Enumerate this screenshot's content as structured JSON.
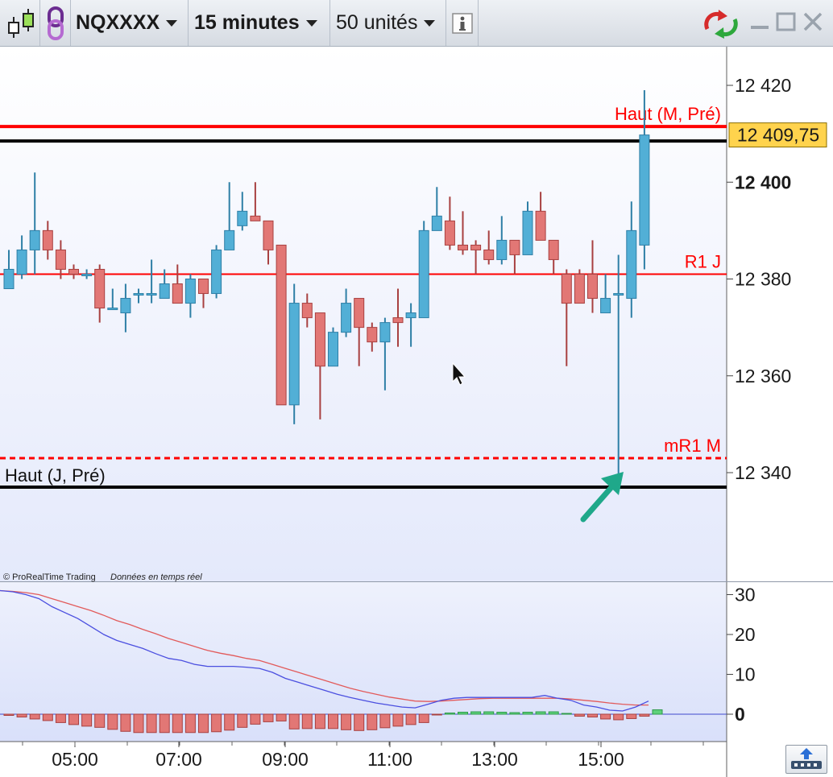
{
  "toolbar": {
    "instrument": "NQXXXX",
    "timeframe": "15 minutes",
    "units": "50 unités",
    "icons": [
      "candlestick-type-icon",
      "link-icon",
      "info-icon",
      "refresh-icon",
      "minimize-icon",
      "maximize-icon",
      "close-icon"
    ]
  },
  "colors": {
    "bull": "#52afd6",
    "bear": "#e27775",
    "resistance": "#ff0000",
    "level_black": "#000000",
    "price_tag": "#ffd34d",
    "macd_line": "#4b4fe0",
    "signal_line": "#e25a5a",
    "arrow": "#1fa88a"
  },
  "price_axis": {
    "ticks": [
      "12 420",
      "12 400",
      "12 380",
      "12 360",
      "12 340"
    ],
    "tick_values": [
      12420,
      12400,
      12380,
      12360,
      12340
    ],
    "bold_tick": "12 400",
    "last_price_label": "12 409,75",
    "last_price": 12409.75
  },
  "levels": [
    {
      "name": "Haut (M, Pré)",
      "price": 12411.5,
      "color": "red",
      "style": "solid"
    },
    {
      "name": "",
      "price": 12408.5,
      "color": "black",
      "style": "solid"
    },
    {
      "name": "R1 J",
      "price": 12381,
      "color": "red",
      "style": "solid-thin"
    },
    {
      "name": "mR1 M",
      "price": 12343,
      "color": "red",
      "style": "dashed"
    },
    {
      "name": "Haut (J, Pré)",
      "price": 12337,
      "color": "black",
      "style": "solid"
    }
  ],
  "credit": {
    "brand": "© ProRealTime Trading",
    "feed": "Données en temps réel"
  },
  "indicator_axis": {
    "ticks": [
      "30",
      "20",
      "10",
      "0"
    ],
    "tick_values": [
      30,
      20,
      10,
      0
    ]
  },
  "time_axis": {
    "labels": [
      "05:00",
      "07:00",
      "09:00",
      "11:00",
      "13:00",
      "15:00"
    ]
  },
  "chart_data": {
    "type": "candlestick",
    "candles": [
      [
        12378,
        12382,
        12386,
        12378
      ],
      [
        12381,
        12386,
        12389,
        12380
      ],
      [
        12386,
        12390,
        12402,
        12381
      ],
      [
        12390,
        12386,
        12392,
        12384
      ],
      [
        12386,
        12382,
        12388,
        12380
      ],
      [
        12382,
        12381,
        12383,
        12380
      ],
      [
        12381,
        12381,
        12382,
        12380
      ],
      [
        12382,
        12374,
        12383,
        12371
      ],
      [
        12374,
        12374,
        12378,
        12374
      ],
      [
        12373,
        12376,
        12379,
        12369
      ],
      [
        12377,
        12377,
        12378,
        12375
      ],
      [
        12377,
        12377,
        12384,
        12375
      ],
      [
        12376,
        12379,
        12382,
        12377
      ],
      [
        12379,
        12375,
        12383,
        12375
      ],
      [
        12375,
        12380,
        12381,
        12372
      ],
      [
        12380,
        12377,
        12380,
        12374
      ],
      [
        12377,
        12386,
        12387,
        12376
      ],
      [
        12386,
        12390,
        12400,
        12386
      ],
      [
        12391,
        12394,
        12398,
        12390
      ],
      [
        12393,
        12392,
        12400,
        12392
      ],
      [
        12392,
        12386,
        12392,
        12383
      ],
      [
        12387,
        12354,
        12387,
        12354
      ],
      [
        12354,
        12375,
        12379,
        12350
      ],
      [
        12375,
        12372,
        12377,
        12370
      ],
      [
        12373,
        12362,
        12373,
        12351
      ],
      [
        12362,
        12369,
        12370,
        12362
      ],
      [
        12369,
        12375,
        12378,
        12368
      ],
      [
        12376,
        12370,
        12376,
        12362
      ],
      [
        12370,
        12367,
        12371,
        12365
      ],
      [
        12367,
        12371,
        12372,
        12357
      ],
      [
        12372,
        12371,
        12378,
        12366
      ],
      [
        12372,
        12373,
        12375,
        12366
      ],
      [
        12372,
        12390,
        12392,
        12372
      ],
      [
        12390,
        12393,
        12399,
        12390
      ],
      [
        12392,
        12387,
        12397,
        12386
      ],
      [
        12387,
        12386,
        12394,
        12385
      ],
      [
        12387,
        12386,
        12388,
        12381
      ],
      [
        12386,
        12384,
        12390,
        12383
      ],
      [
        12384,
        12388,
        12393,
        12383
      ],
      [
        12388,
        12385,
        12388,
        12381
      ],
      [
        12385,
        12394,
        12396,
        12386
      ],
      [
        12394,
        12388,
        12398,
        12388
      ],
      [
        12388,
        12384,
        12388,
        12381
      ],
      [
        12381,
        12375,
        12382,
        12362
      ],
      [
        12381,
        12375,
        12382,
        12375
      ],
      [
        12381,
        12376,
        12388,
        12373
      ],
      [
        12373,
        12376,
        12381,
        12373
      ],
      [
        12377,
        12377,
        12385,
        12336
      ],
      [
        12376,
        12390,
        12396,
        12372
      ],
      [
        12387,
        12409.75,
        12419,
        12382
      ]
    ],
    "macd_series": [
      {
        "name": "",
        "values": [
          31,
          30.7,
          30,
          29,
          27,
          25.5,
          24,
          22,
          20,
          18.5,
          17.5,
          16.5,
          15.2,
          14,
          13.5,
          12.5,
          12,
          12,
          12,
          11.8,
          11.5,
          10.5,
          9,
          8,
          7,
          6,
          5,
          4.2,
          3.5,
          2.8,
          2.3,
          1.8,
          1.6,
          2.5,
          3.5,
          4,
          4.2,
          4.2,
          4.2,
          4.2,
          4.2,
          4.2,
          4.7,
          4,
          3.5,
          2.3,
          1.8,
          1,
          0.8,
          1.8,
          3.3
        ]
      },
      {
        "name": "",
        "values": [
          31,
          30.8,
          30.5,
          30,
          29,
          28,
          27,
          26,
          24.8,
          23.5,
          22.5,
          21.3,
          20.2,
          19,
          18,
          17,
          16,
          15.3,
          14.7,
          14,
          13.5,
          12.5,
          11.5,
          10.5,
          9.5,
          8.5,
          7.5,
          6.5,
          5.7,
          5,
          4.3,
          3.8,
          3.3,
          3.2,
          3.3,
          3.5,
          3.7,
          3.9,
          4,
          4,
          4,
          4,
          4,
          4,
          3.8,
          3.5,
          3.2,
          2.8,
          2.5,
          2.3,
          2.3
        ]
      }
    ],
    "histogram": [
      -0.3,
      -0.7,
      -1.2,
      -1.6,
      -2.1,
      -2.6,
      -3,
      -3.3,
      -3.8,
      -4.3,
      -4.6,
      -4.6,
      -4.6,
      -4.6,
      -4.6,
      -4.6,
      -4.4,
      -4,
      -3.3,
      -2.5,
      -1.9,
      -1.7,
      -3.7,
      -3.6,
      -3.6,
      -3.6,
      -3.9,
      -4.1,
      -3.9,
      -3.4,
      -3,
      -2.6,
      -2.1,
      -0.2,
      0.3,
      0.5,
      0.6,
      0.6,
      0.5,
      0.4,
      0.5,
      0.6,
      0.6,
      0.2,
      -0.5,
      -0.7,
      -1.2,
      -1.4,
      -1.1,
      -0.5,
      1.1
    ]
  }
}
